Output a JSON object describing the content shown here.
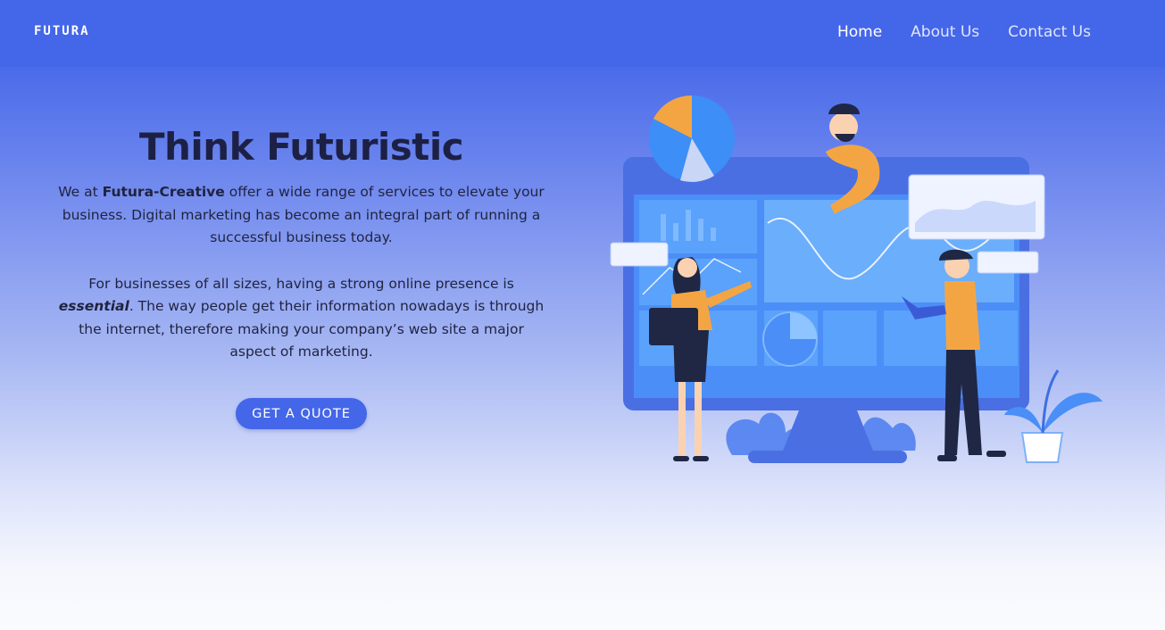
{
  "header": {
    "logo_text": "FUTURA",
    "nav": [
      {
        "label": "Home",
        "active": true
      },
      {
        "label": "About Us",
        "active": false
      },
      {
        "label": "Contact Us",
        "active": false
      }
    ]
  },
  "hero": {
    "title": "Think Futuristic",
    "para1": {
      "pre": "We at ",
      "brand": "Futura-Creative",
      "post": " offer a wide range of services to elevate your business. Digital marketing has become an integral part of running a successful business today."
    },
    "para2": {
      "pre": "For businesses of all sizes, having a strong online presence is ",
      "emphasis": "essential",
      "post": ". The way people get their information nowadays is through the internet, therefore making your company’s web site a major aspect of marketing."
    },
    "cta_label": "GET A QUOTE"
  },
  "colors": {
    "brand_blue": "#4466e8",
    "accent_orange": "#f4a543",
    "dark_navy": "#1d2045"
  },
  "illustration": {
    "icon": "marketing-dashboard-illustration"
  }
}
